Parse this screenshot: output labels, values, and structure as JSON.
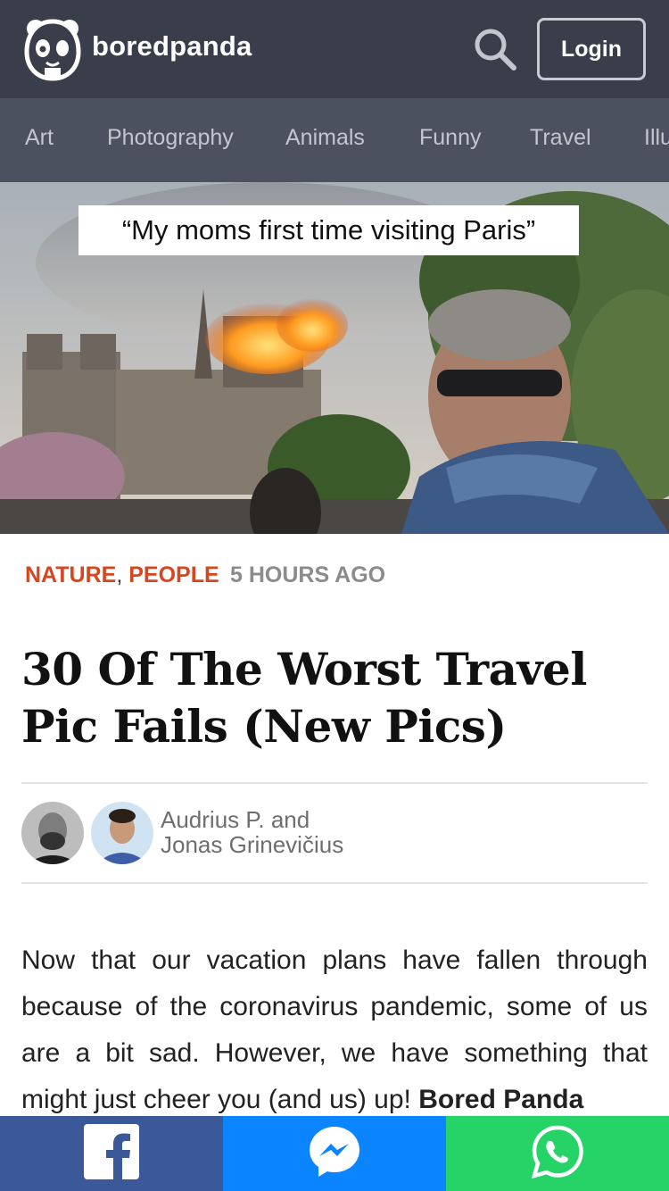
{
  "header": {
    "brand": "boredpanda",
    "login_label": "Login"
  },
  "categories": [
    "Art",
    "Photography",
    "Animals",
    "Funny",
    "Travel",
    "Illu"
  ],
  "hero": {
    "caption": "“My moms first time visiting Paris”"
  },
  "meta": {
    "tags": [
      "NATURE",
      "PEOPLE"
    ],
    "tag_separator": ",",
    "time": "5 HOURS AGO"
  },
  "article": {
    "title": "30 Of The Worst Travel Pic Fails (New Pics)",
    "authors_line1": "Audrius P. and",
    "authors_line2": "Jonas Grinevičius",
    "intro": "Now that our vacation plans have fallen through because of the coronavirus pandemic, some of us are a bit sad. However, we have something that might just cheer you (and us) up!",
    "intro_bold": "Bored Panda"
  },
  "icons": {
    "logo": "panda-icon",
    "search": "search-icon",
    "facebook": "facebook-icon",
    "messenger": "messenger-icon",
    "whatsapp": "whatsapp-icon"
  },
  "colors": {
    "header_bg": "#3a3e4a",
    "nav_bg": "#4c5160",
    "tag": "#d9451f",
    "facebook": "#3b5998",
    "messenger": "#0a84ff",
    "whatsapp": "#25d366"
  }
}
